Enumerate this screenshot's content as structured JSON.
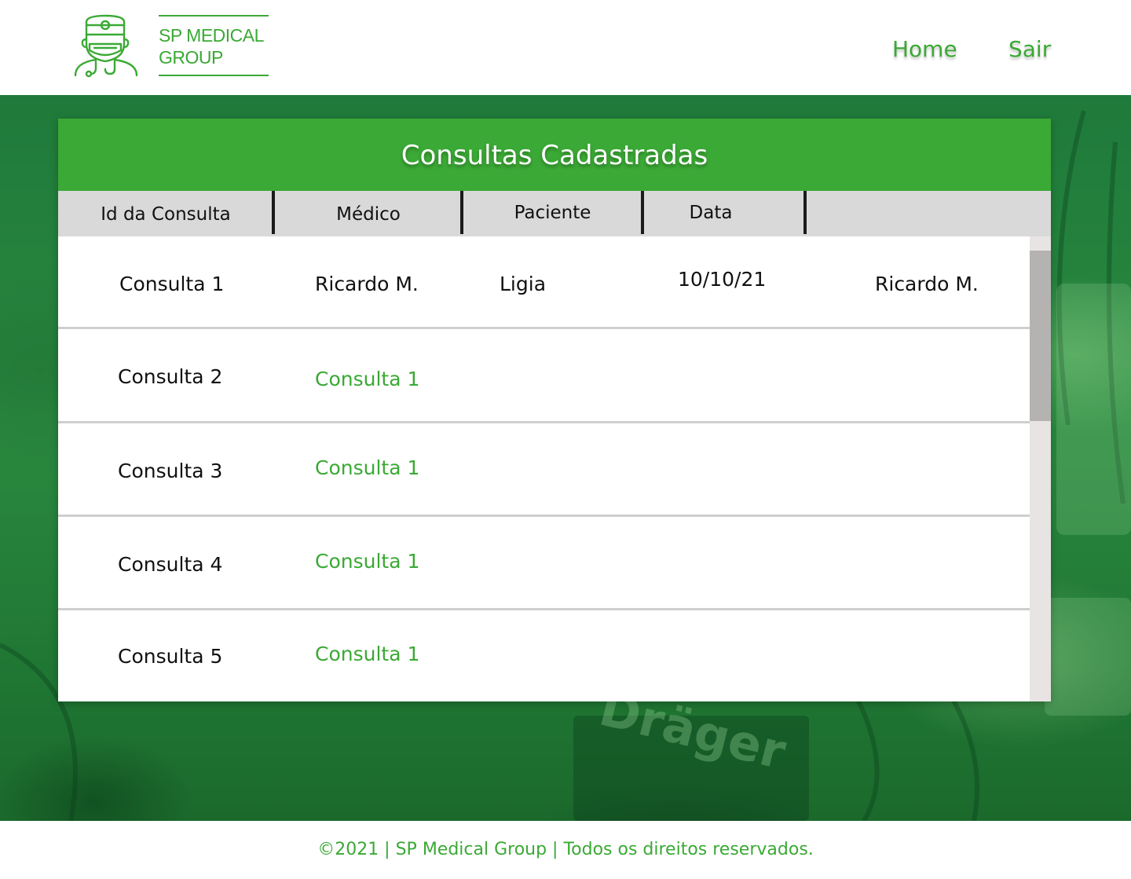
{
  "brand": {
    "line1": "SP MEDICAL",
    "line2": "GROUP",
    "icon": "doctor-icon",
    "color": "#3ba935"
  },
  "nav": {
    "home": "Home",
    "logout": "Sair"
  },
  "table": {
    "title": "Consultas Cadastradas",
    "columns": [
      "Id da Consulta",
      "Médico",
      "Paciente",
      "Data",
      ""
    ],
    "rows": [
      {
        "id": "Consulta 1",
        "medico": "Ricardo M.",
        "paciente": "Ligia",
        "data": "10/10/21",
        "extra": "Ricardo M."
      },
      {
        "id": "Consulta 2",
        "medico": "Consulta 1",
        "paciente": "",
        "data": "",
        "extra": ""
      },
      {
        "id": "Consulta 3",
        "medico": "Consulta 1",
        "paciente": "",
        "data": "",
        "extra": ""
      },
      {
        "id": "Consulta 4",
        "medico": "Consulta 1",
        "paciente": "",
        "data": "",
        "extra": ""
      },
      {
        "id": "Consulta 5",
        "medico": "Consulta 1",
        "paciente": "",
        "data": "",
        "extra": ""
      }
    ]
  },
  "colors": {
    "accent": "#3ba935",
    "header_bg": "#d9d9d9",
    "scroll_track": "#e8e4e3",
    "scroll_thumb": "#b5b3b2"
  },
  "footer": {
    "text": "©2021 | SP Medical Group | Todos os direitos reservados."
  }
}
